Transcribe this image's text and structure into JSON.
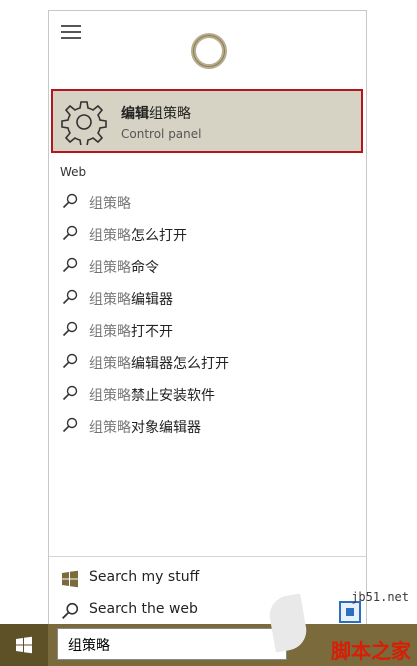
{
  "best_match": {
    "title_bold": "编辑",
    "title_rest": "组策略",
    "subtitle": "Control panel",
    "icon": "gear-icon"
  },
  "web_section_label": "Web",
  "web_suggestions": [
    {
      "typed": "组策略",
      "suffix": ""
    },
    {
      "typed": "组策略",
      "suffix": "怎么打开"
    },
    {
      "typed": "组策略",
      "suffix": "命令"
    },
    {
      "typed": "组策略",
      "suffix": "编辑器"
    },
    {
      "typed": "组策略",
      "suffix": "打不开"
    },
    {
      "typed": "组策略",
      "suffix": "编辑器怎么打开"
    },
    {
      "typed": "组策略",
      "suffix": "禁止安装软件"
    },
    {
      "typed": "组策略",
      "suffix": "对象编辑器"
    }
  ],
  "bottom": {
    "search_my_stuff": "Search my stuff",
    "search_the_web": "Search the web"
  },
  "taskbar": {
    "search_value": "组策略"
  },
  "watermark": {
    "url": "jb51.net",
    "name": "脚本之家"
  },
  "colors": {
    "highlight_bg": "#d6d2c4",
    "highlight_border": "#b3161c",
    "taskbar": "#7a6a3c",
    "cortana_ring": "#b8ad8c"
  }
}
